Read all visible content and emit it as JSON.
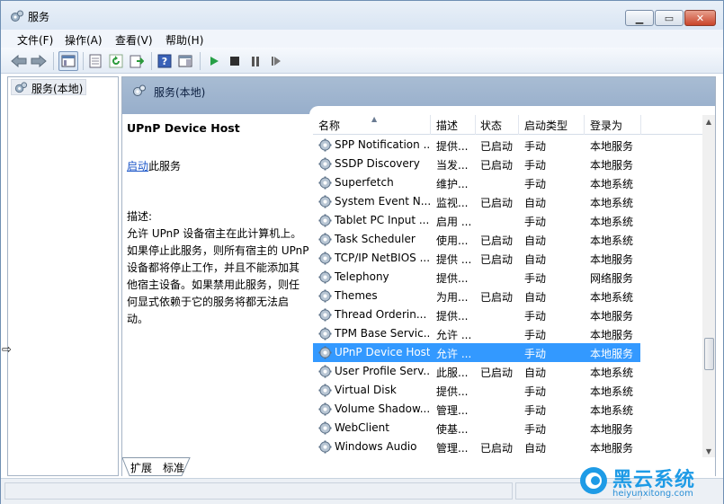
{
  "window": {
    "title": "服务"
  },
  "menu": [
    "文件(F)",
    "操作(A)",
    "查看(V)",
    "帮助(H)"
  ],
  "toolbar": {
    "icons": [
      "back-icon",
      "forward-icon",
      "show-hide-tree-icon",
      "properties-icon",
      "refresh-icon",
      "export-list-icon",
      "help-icon",
      "show-hide-action-pane-icon",
      "start-service-icon",
      "stop-service-icon",
      "pause-service-icon",
      "resume-service-icon"
    ]
  },
  "tree": {
    "root_label": "服务(本地)"
  },
  "content": {
    "header_title": "服务(本地)",
    "selected_name": "UPnP Device Host",
    "start_link": "启动",
    "start_suffix": "此服务",
    "desc_label": "描述:",
    "desc_text": "允许 UPnP 设备宿主在此计算机上。如果停止此服务，则所有宿主的 UPnP 设备都将停止工作，并且不能添加其他宿主设备。如果禁用此服务，则任何显式依赖于它的服务将都无法启动。"
  },
  "columns": [
    "名称",
    "描述",
    "状态",
    "启动类型",
    "登录为"
  ],
  "services": [
    {
      "name": "SPP Notification ...",
      "desc": "提供...",
      "status": "已启动",
      "startup": "手动",
      "logon": "本地服务"
    },
    {
      "name": "SSDP Discovery",
      "desc": "当发...",
      "status": "已启动",
      "startup": "手动",
      "logon": "本地服务"
    },
    {
      "name": "Superfetch",
      "desc": "维护...",
      "status": "",
      "startup": "手动",
      "logon": "本地系统"
    },
    {
      "name": "System Event N...",
      "desc": "监视...",
      "status": "已启动",
      "startup": "自动",
      "logon": "本地系统"
    },
    {
      "name": "Tablet PC Input ...",
      "desc": "启用 ...",
      "status": "",
      "startup": "手动",
      "logon": "本地系统"
    },
    {
      "name": "Task Scheduler",
      "desc": "使用...",
      "status": "已启动",
      "startup": "自动",
      "logon": "本地系统"
    },
    {
      "name": "TCP/IP NetBIOS ...",
      "desc": "提供 ...",
      "status": "已启动",
      "startup": "自动",
      "logon": "本地服务"
    },
    {
      "name": "Telephony",
      "desc": "提供...",
      "status": "",
      "startup": "手动",
      "logon": "网络服务"
    },
    {
      "name": "Themes",
      "desc": "为用...",
      "status": "已启动",
      "startup": "自动",
      "logon": "本地系统"
    },
    {
      "name": "Thread Orderin...",
      "desc": "提供...",
      "status": "",
      "startup": "手动",
      "logon": "本地服务"
    },
    {
      "name": "TPM Base Servic...",
      "desc": "允许 ...",
      "status": "",
      "startup": "手动",
      "logon": "本地服务"
    },
    {
      "name": "UPnP Device Host",
      "desc": "允许 ...",
      "status": "",
      "startup": "手动",
      "logon": "本地服务",
      "selected": true
    },
    {
      "name": "User Profile Serv...",
      "desc": "此服...",
      "status": "已启动",
      "startup": "自动",
      "logon": "本地系统"
    },
    {
      "name": "Virtual Disk",
      "desc": "提供...",
      "status": "",
      "startup": "手动",
      "logon": "本地系统"
    },
    {
      "name": "Volume Shadow...",
      "desc": "管理...",
      "status": "",
      "startup": "手动",
      "logon": "本地系统"
    },
    {
      "name": "WebClient",
      "desc": "使基...",
      "status": "",
      "startup": "手动",
      "logon": "本地服务"
    },
    {
      "name": "Windows Audio",
      "desc": "管理...",
      "status": "已启动",
      "startup": "自动",
      "logon": "本地服务"
    }
  ],
  "tabs": [
    "扩展",
    "标准"
  ],
  "watermark": {
    "title": "黑云系统",
    "url": "heiyunxitong.com"
  },
  "colors": {
    "selection": "#3399ff",
    "header_band": "#a8bcd3",
    "link": "#1a55c8"
  }
}
